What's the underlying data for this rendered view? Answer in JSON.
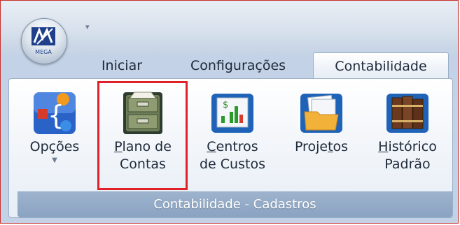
{
  "app": {
    "logo_text": "MEGA"
  },
  "tabs": [
    {
      "label": "Iniciar"
    },
    {
      "label": "Configurações"
    },
    {
      "label": "Contabilidade",
      "selected": true
    }
  ],
  "group": {
    "label": "Contabilidade - Cadastros"
  },
  "buttons": {
    "opcoes": {
      "line1": "Opções",
      "has_dropdown": true
    },
    "plano": {
      "line1_access": "P",
      "line1_rest": "lano de",
      "line2": "Contas"
    },
    "centros": {
      "line1_access": "C",
      "line1_rest": "entros",
      "line2": "de Custos"
    },
    "projetos": {
      "line1_before": "Proje",
      "line1_access": "t",
      "line1_after": "os"
    },
    "historico": {
      "line1_access": "H",
      "line1_rest": "istórico",
      "line2": "Padrão"
    }
  },
  "colors": {
    "highlight": "#e0202b",
    "group_bar": "#8aa3c2"
  }
}
